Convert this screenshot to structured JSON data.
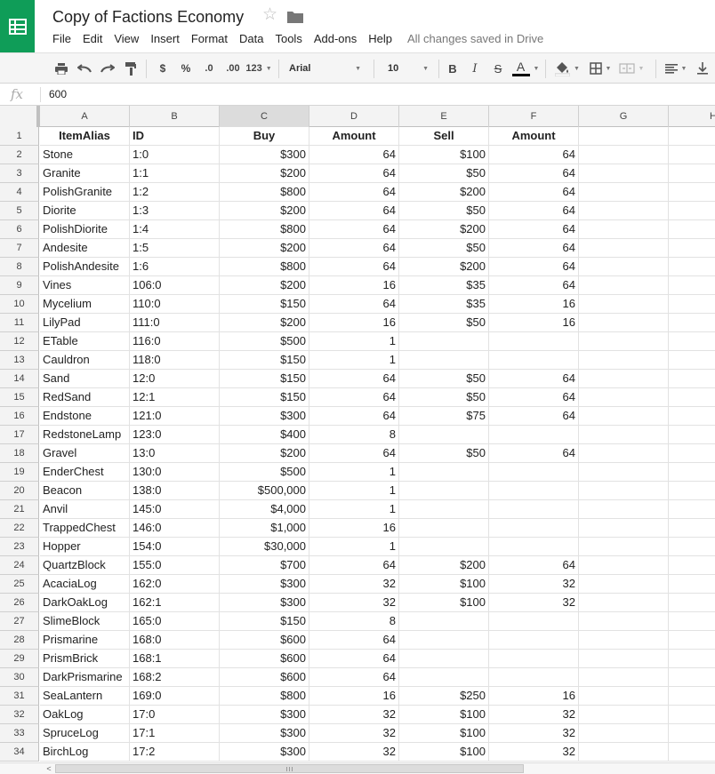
{
  "app": {
    "title": "Copy of Factions Economy",
    "save_status": "All changes saved in Drive",
    "colors": {
      "brand": "#0f9d58",
      "accent_text": "#000000"
    }
  },
  "menu": [
    "File",
    "Edit",
    "View",
    "Insert",
    "Format",
    "Data",
    "Tools",
    "Add-ons",
    "Help"
  ],
  "toolbar": {
    "currency": "$",
    "percent": "%",
    "decimal_decrease": ".0",
    "decimal_increase": ".00",
    "more_formats": "123",
    "font": "Arial",
    "font_size": "10",
    "bold": "B",
    "italic": "I",
    "strikethrough": "S",
    "text_color": "A",
    "icons": [
      "print-icon",
      "undo-icon",
      "redo-icon",
      "paint-format-icon",
      "fill-color-icon",
      "borders-icon",
      "merge-icon",
      "align-icon",
      "valign-icon"
    ]
  },
  "formula_bar": {
    "fx": "fx",
    "value": "600"
  },
  "grid": {
    "columns": [
      "A",
      "B",
      "C",
      "D",
      "E",
      "F",
      "G",
      "H"
    ],
    "selected_column": "C",
    "rows": [
      {
        "n": "1",
        "cells": [
          "ItemAlias",
          "ID",
          "Buy",
          "Amount",
          "Sell",
          "Amount"
        ]
      },
      {
        "n": "2",
        "cells": [
          "Stone",
          "1:0",
          "$300",
          "64",
          "$100",
          "64"
        ]
      },
      {
        "n": "3",
        "cells": [
          "Granite",
          "1:1",
          "$200",
          "64",
          "$50",
          "64"
        ]
      },
      {
        "n": "4",
        "cells": [
          "PolishGranite",
          "1:2",
          "$800",
          "64",
          "$200",
          "64"
        ]
      },
      {
        "n": "5",
        "cells": [
          "Diorite",
          "1:3",
          "$200",
          "64",
          "$50",
          "64"
        ]
      },
      {
        "n": "6",
        "cells": [
          "PolishDiorite",
          "1:4",
          "$800",
          "64",
          "$200",
          "64"
        ]
      },
      {
        "n": "7",
        "cells": [
          "Andesite",
          "1:5",
          "$200",
          "64",
          "$50",
          "64"
        ]
      },
      {
        "n": "8",
        "cells": [
          "PolishAndesite",
          "1:6",
          "$800",
          "64",
          "$200",
          "64"
        ]
      },
      {
        "n": "9",
        "cells": [
          "Vines",
          "106:0",
          "$200",
          "16",
          "$35",
          "64"
        ]
      },
      {
        "n": "10",
        "cells": [
          "Mycelium",
          "110:0",
          "$150",
          "64",
          "$35",
          "16"
        ]
      },
      {
        "n": "11",
        "cells": [
          "LilyPad",
          "111:0",
          "$200",
          "16",
          "$50",
          "16"
        ]
      },
      {
        "n": "12",
        "cells": [
          "ETable",
          "116:0",
          "$500",
          "1",
          "",
          ""
        ]
      },
      {
        "n": "13",
        "cells": [
          "Cauldron",
          "118:0",
          "$150",
          "1",
          "",
          ""
        ]
      },
      {
        "n": "14",
        "cells": [
          "Sand",
          "12:0",
          "$150",
          "64",
          "$50",
          "64"
        ]
      },
      {
        "n": "15",
        "cells": [
          "RedSand",
          "12:1",
          "$150",
          "64",
          "$50",
          "64"
        ]
      },
      {
        "n": "16",
        "cells": [
          "Endstone",
          "121:0",
          "$300",
          "64",
          "$75",
          "64"
        ]
      },
      {
        "n": "17",
        "cells": [
          "RedstoneLamp",
          "123:0",
          "$400",
          "8",
          "",
          ""
        ]
      },
      {
        "n": "18",
        "cells": [
          "Gravel",
          "13:0",
          "$200",
          "64",
          "$50",
          "64"
        ]
      },
      {
        "n": "19",
        "cells": [
          "EnderChest",
          "130:0",
          "$500",
          "1",
          "",
          ""
        ]
      },
      {
        "n": "20",
        "cells": [
          "Beacon",
          "138:0",
          "$500,000",
          "1",
          "",
          ""
        ]
      },
      {
        "n": "21",
        "cells": [
          "Anvil",
          "145:0",
          "$4,000",
          "1",
          "",
          ""
        ]
      },
      {
        "n": "22",
        "cells": [
          "TrappedChest",
          "146:0",
          "$1,000",
          "16",
          "",
          ""
        ]
      },
      {
        "n": "23",
        "cells": [
          "Hopper",
          "154:0",
          "$30,000",
          "1",
          "",
          ""
        ]
      },
      {
        "n": "24",
        "cells": [
          "QuartzBlock",
          "155:0",
          "$700",
          "64",
          "$200",
          "64"
        ]
      },
      {
        "n": "25",
        "cells": [
          "AcaciaLog",
          "162:0",
          "$300",
          "32",
          "$100",
          "32"
        ]
      },
      {
        "n": "26",
        "cells": [
          "DarkOakLog",
          "162:1",
          "$300",
          "32",
          "$100",
          "32"
        ]
      },
      {
        "n": "27",
        "cells": [
          "SlimeBlock",
          "165:0",
          "$150",
          "8",
          "",
          ""
        ]
      },
      {
        "n": "28",
        "cells": [
          "Prismarine",
          "168:0",
          "$600",
          "64",
          "",
          ""
        ]
      },
      {
        "n": "29",
        "cells": [
          "PrismBrick",
          "168:1",
          "$600",
          "64",
          "",
          ""
        ]
      },
      {
        "n": "30",
        "cells": [
          "DarkPrismarine",
          "168:2",
          "$600",
          "64",
          "",
          ""
        ]
      },
      {
        "n": "31",
        "cells": [
          "SeaLantern",
          "169:0",
          "$800",
          "16",
          "$250",
          "16"
        ]
      },
      {
        "n": "32",
        "cells": [
          "OakLog",
          "17:0",
          "$300",
          "32",
          "$100",
          "32"
        ]
      },
      {
        "n": "33",
        "cells": [
          "SpruceLog",
          "17:1",
          "$300",
          "32",
          "$100",
          "32"
        ]
      },
      {
        "n": "34",
        "cells": [
          "BirchLog",
          "17:2",
          "$300",
          "32",
          "$100",
          "32"
        ]
      }
    ]
  }
}
